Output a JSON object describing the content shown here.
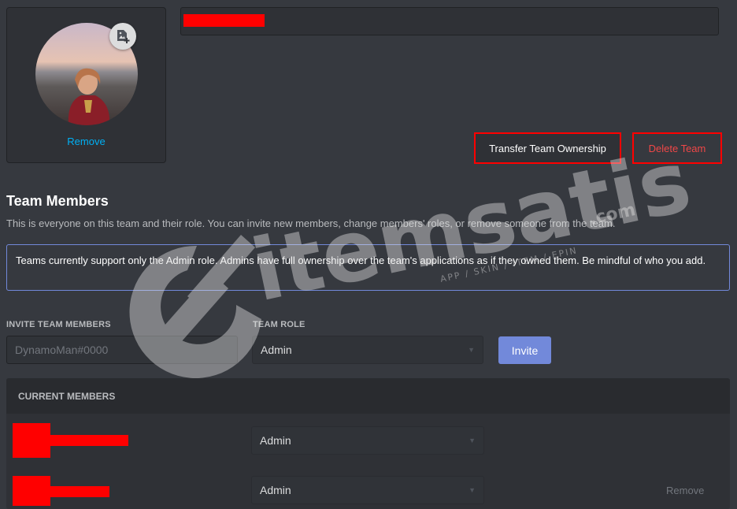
{
  "profile": {
    "remove_label": "Remove"
  },
  "actions": {
    "transfer_label": "Transfer Team Ownership",
    "delete_label": "Delete Team"
  },
  "team_members": {
    "title": "Team Members",
    "description": "This is everyone on this team and their role. You can invite new members, change members' roles, or remove someone from the team.",
    "notice": "Teams currently support only the Admin role. Admins have full ownership over the team's applications as if they owned them. Be mindful of who you add."
  },
  "invite": {
    "members_label": "INVITE TEAM MEMBERS",
    "placeholder": "DynamoMan#0000",
    "role_label": "TEAM ROLE",
    "role_value": "Admin",
    "button_label": "Invite"
  },
  "current_members": {
    "header": "CURRENT MEMBERS",
    "members": [
      {
        "role": "Admin"
      },
      {
        "role": "Admin",
        "remove_label": "Remove"
      }
    ]
  },
  "watermark": {
    "brand": "itemsatis",
    "tld": ".com",
    "tagline": "APP / SKIN / ITEM / EPIN"
  },
  "colors": {
    "background": "#36393f",
    "accent": "#7289da",
    "link": "#00b0f4",
    "danger": "#f04747",
    "redaction": "#ff0000"
  },
  "icons": {
    "upload": "image-add-icon",
    "select_caret": "chevron-down-icon"
  }
}
